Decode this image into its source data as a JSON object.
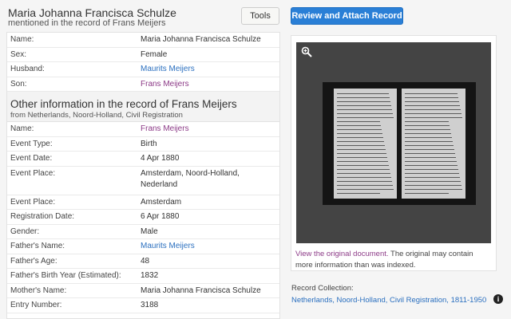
{
  "header": {
    "person_name": "Maria Johanna Francisca Schulze",
    "subtitle": "mentioned in the record of Frans Meijers",
    "tools_label": "Tools",
    "review_label": "Review and Attach Record"
  },
  "person": [
    {
      "label": "Name:",
      "value": "Maria Johanna Francisca Schulze",
      "link": false
    },
    {
      "label": "Sex:",
      "value": "Female",
      "link": false
    },
    {
      "label": "Husband:",
      "value": "Maurits Meijers",
      "link": "blue"
    },
    {
      "label": "Son:",
      "value": "Frans Meijers",
      "link": "purple"
    }
  ],
  "other": {
    "title": "Other information in the record of Frans Meijers",
    "subtitle": "from Netherlands, Noord-Holland, Civil Registration",
    "rows": [
      {
        "label": "Name:",
        "value": "Frans Meijers",
        "link": "purple"
      },
      {
        "label": "Event Type:",
        "value": "Birth"
      },
      {
        "label": "Event Date:",
        "value": "4 Apr 1880"
      },
      {
        "label": "Event Place:",
        "value": "Amsterdam, Noord-Holland, Nederland"
      },
      {
        "label": "Event Place:",
        "value": "Amsterdam"
      },
      {
        "label": "Registration Date:",
        "value": "6 Apr 1880"
      },
      {
        "label": "Gender:",
        "value": "Male"
      },
      {
        "label": "Father's Name:",
        "value": "Maurits Meijers",
        "link": "blue"
      },
      {
        "label": "Father's Age:",
        "value": "48"
      },
      {
        "label": "Father's Birth Year (Estimated):",
        "value": "1832"
      },
      {
        "label": "Mother's Name:",
        "value": "Maria Johanna Francisca Schulze"
      },
      {
        "label": "Entry Number:",
        "value": "3188"
      }
    ]
  },
  "viewer": {
    "link_text": "View the original document.",
    "note_text": " The original may contain more information than was indexed.",
    "zoom_icon": "zoom-in-icon"
  },
  "collection": {
    "label": "Record Collection:",
    "link": "Netherlands, Noord-Holland, Civil Registration, 1811-1950",
    "info_icon": "info-icon",
    "info_glyph": "i"
  },
  "colors": {
    "primary": "#2a7fd6",
    "link_blue": "#2a6fbf",
    "link_purple": "#8c3a87"
  }
}
